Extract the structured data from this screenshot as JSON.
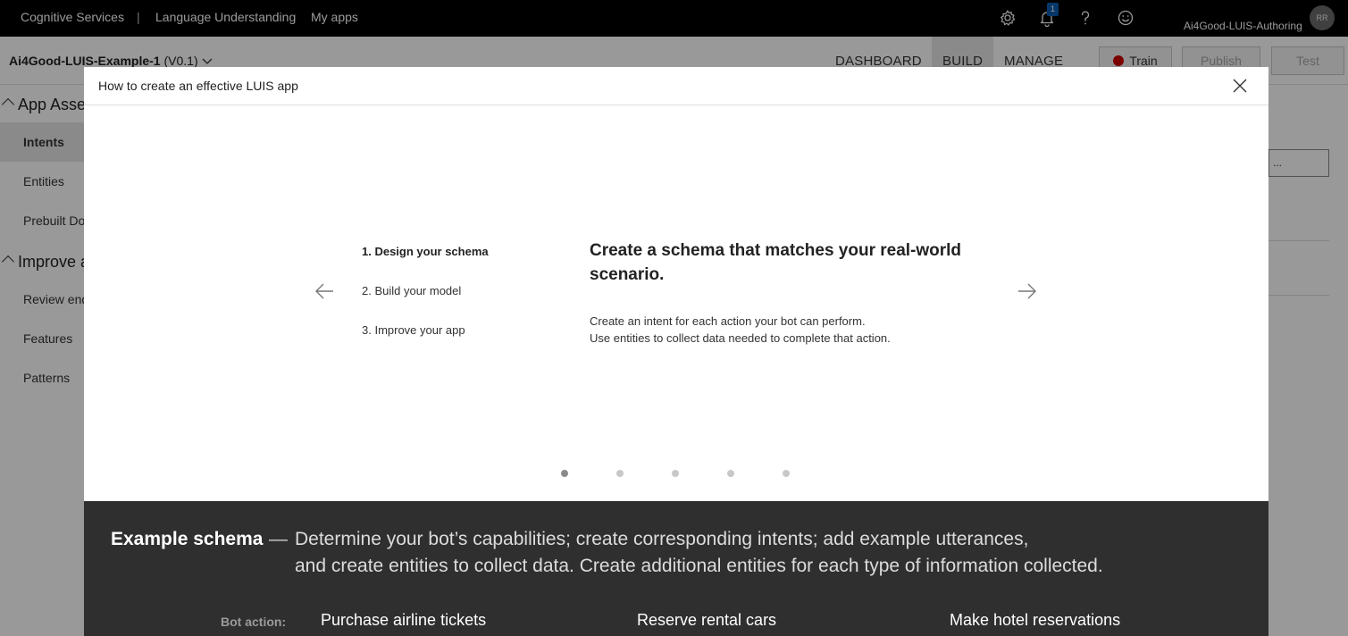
{
  "topbar": {
    "product": "Cognitive Services",
    "separator": "|",
    "service": "Language Understanding",
    "my_apps": "My apps",
    "notification_count": "1",
    "account": "Ai4Good-LUIS-Authoring",
    "avatar_initials": "RR",
    "icons": [
      "gear-icon",
      "bell-icon",
      "help-icon",
      "smiley-icon"
    ]
  },
  "header": {
    "app_name": "Ai4Good-LUIS-Example-1",
    "version": "(V0.1)",
    "tabs": [
      "DASHBOARD",
      "BUILD",
      "MANAGE"
    ],
    "train_label": "Train",
    "publish_label": "Publish",
    "test_label": "Test"
  },
  "sidebar": {
    "section1": "App Assets",
    "items1": [
      "Intents",
      "Entities",
      "Prebuilt Domains"
    ],
    "section2": "Improve app performance",
    "items2": [
      "Review endpoint utterances",
      "Features",
      "Patterns"
    ]
  },
  "background": {
    "box_text": "..."
  },
  "modal": {
    "title": "How to create an effective LUIS app",
    "steps": [
      "1. Design your schema",
      "2. Build your model",
      "3. Improve your app"
    ],
    "headline": "Create a schema that matches your real-world scenario.",
    "desc_line1": "Create an intent for each action your bot can perform.",
    "desc_line2": "Use entities to collect data needed to complete that action.",
    "page_count": 5,
    "current_page": 1,
    "example": {
      "title": "Example schema",
      "dash": "—",
      "line1": "Determine your bot’s capabilities; create corresponding intents; add example utterances,",
      "line2": "and create entities to collect data. Create additional entities for each type of information collected.",
      "bot_action_label": "Bot action:",
      "actions": [
        "Purchase airline tickets",
        "Reserve rental cars",
        "Make hotel reservations"
      ]
    }
  },
  "colors": {
    "topbar_bg": "#000000",
    "train_dot": "#cc0000",
    "dark_panel": "#2f2f2f",
    "badge": "#0b5cad"
  }
}
